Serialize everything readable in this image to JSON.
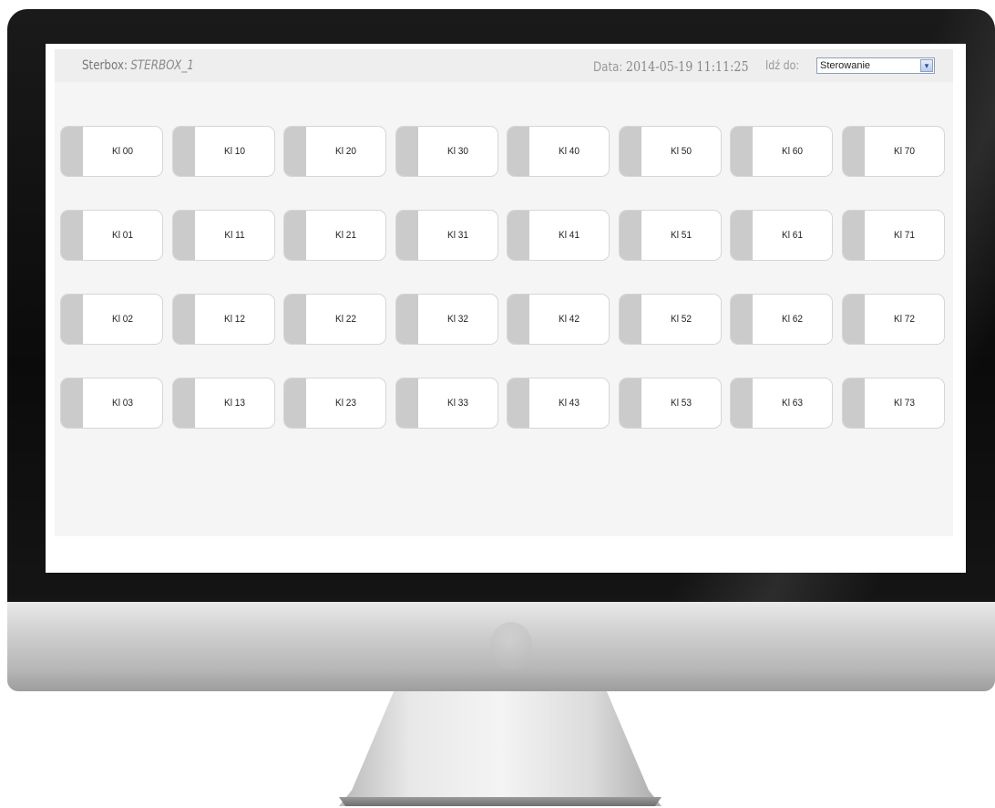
{
  "header": {
    "sterbox_label": "Sterbox:",
    "sterbox_name": "STERBOX_1",
    "date_label": "Data:",
    "date_value": "2014-05-19 11:11:25",
    "goto_label": "Idź do:",
    "goto_selected": "Sterowanie"
  },
  "buttons": [
    "Kl 00",
    "Kl 10",
    "Kl 20",
    "Kl 30",
    "Kl 40",
    "Kl 50",
    "Kl 60",
    "Kl 70",
    "Kl 01",
    "Kl 11",
    "Kl 21",
    "Kl 31",
    "Kl 41",
    "Kl 51",
    "Kl 61",
    "Kl 71",
    "Kl 02",
    "Kl 12",
    "Kl 22",
    "Kl 32",
    "Kl 42",
    "Kl 52",
    "Kl 62",
    "Kl 72",
    "Kl 03",
    "Kl 13",
    "Kl 23",
    "Kl 33",
    "Kl 43",
    "Kl 53",
    "Kl 63",
    "Kl 73"
  ],
  "colors": {
    "button_side": "#cbcbcb",
    "panel_background": "#f5f5f5",
    "select_border": "#8f9fb8"
  },
  "icons": {
    "dropdown": "chevron-down-icon",
    "brand": "logo-icon"
  }
}
